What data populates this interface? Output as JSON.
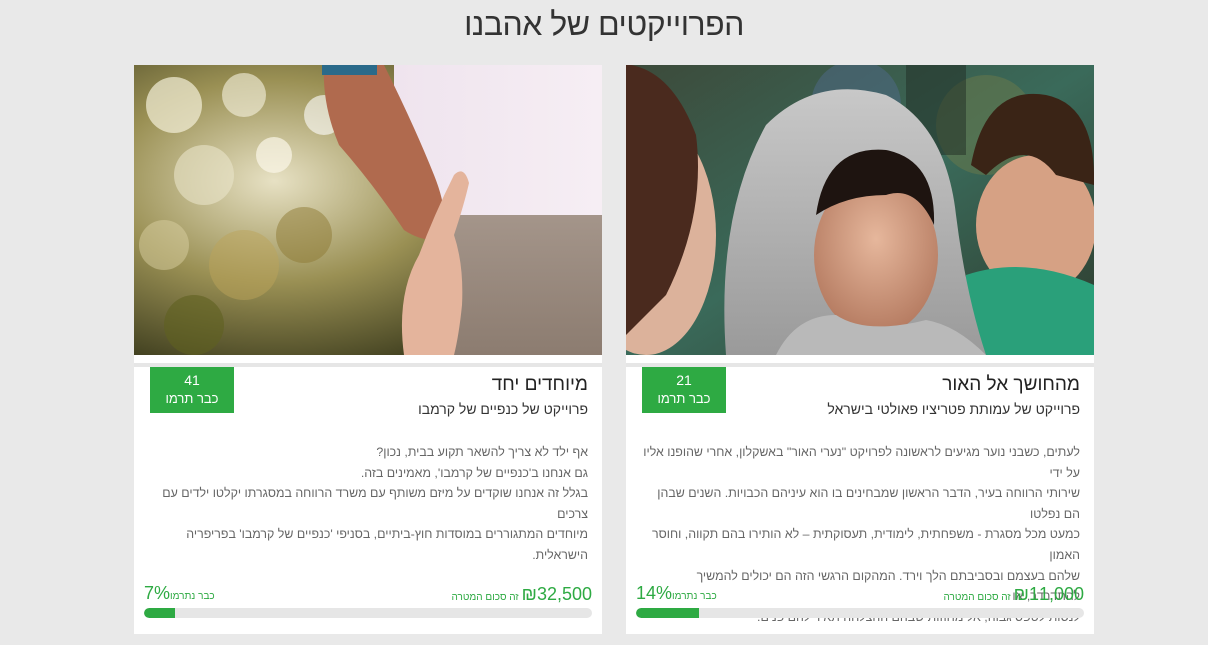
{
  "section": {
    "title": "הפרוייקטים של אהבנו"
  },
  "colors": {
    "accent": "#2eaa43",
    "background": "#e9e9e9",
    "card": "#ffffff",
    "progress_track": "#e6e6e6"
  },
  "projects": [
    {
      "title": "מהחושך אל האור",
      "subtitle": "פרוייקט של עמותת פטריציו פאולטי בישראל",
      "donors_count": "21",
      "donors_label": "כבר תרמו",
      "description": [
        "לעתים, כשבני נוער מגיעים לראשונה לפרויקט \"נערי האור\" באשקלון, אחרי שהופנו אליו על ידי",
        "שירותי הרווחה בעיר, הדבר הראשון שמבחינים בו הוא עיניהם הכבויות. השנים שבהן הם נפלטו",
        "כמעט מכל מסגרת - משפחתית, לימודית, תעסוקתית – לא הותירו בהם תקווה, וחוסר האמון",
        "שלהם בעצמם ובסביבתם הלך וירד. המהקום הרגשי הזה הם יכולים להמשיך להתדרדר, או",
        "לנסות לטפס גבוה, אל מחוזות שבהם ההצלחה תאיר להם פנים."
      ],
      "amount": "₪11,000",
      "amount_label": "זה סכום המטרה",
      "percent_text": "14%",
      "percent_label": "כבר נתרמו",
      "progress_fraction": 0.14,
      "image_icon": "teen-hoodie-photo"
    },
    {
      "title": "מיוחדים יחד",
      "subtitle": "פרוייקט של כנפיים של קרמבו",
      "donors_count": "41",
      "donors_label": "כבר תרמו",
      "description": [
        "אף ילד לא צריך להשאר תקוע בבית, נכון?",
        "גם אנחנו ב'כנפיים של קרמבו', מאמינים בזה.",
        "בגלל זה אנחנו שוקדים על מיזם משותף עם משרד הרווחה במסגרתו יקלטו ילדים עם צרכים",
        "מיוחדים המתגוררים במוסדות חוץ-ביתיים, בסניפי 'כנפיים של קרמבו' בפריפריה הישראלית."
      ],
      "amount": "₪32,500",
      "amount_label": "זה סכום המטרה",
      "percent_text": "7%",
      "percent_label": "כבר נתרמו",
      "progress_fraction": 0.07,
      "image_icon": "hands-reaching-photo"
    }
  ]
}
